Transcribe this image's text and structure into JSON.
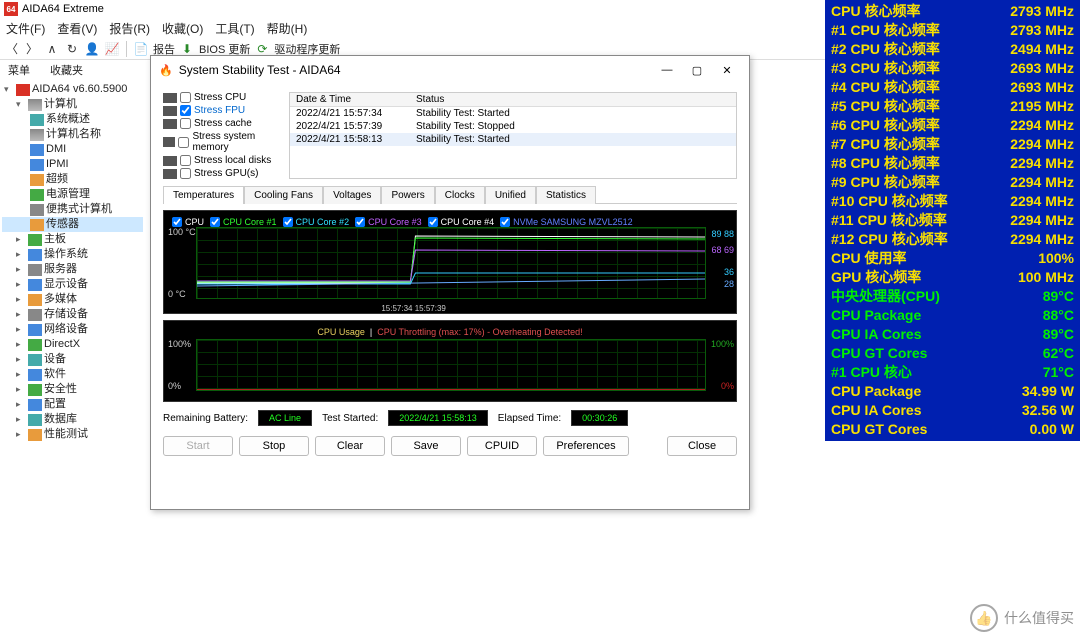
{
  "app": {
    "title": "AIDA64 Extreme"
  },
  "menu": [
    "文件(F)",
    "查看(V)",
    "报告(R)",
    "收藏(O)",
    "工具(T)",
    "帮助(H)"
  ],
  "toolbar": {
    "report": "报告",
    "bios": "BIOS 更新",
    "driver": "驱动程序更新"
  },
  "subheader": {
    "menu": "菜单",
    "fav": "收藏夹"
  },
  "tree": {
    "root": "AIDA64 v6.60.5900",
    "computer": "计算机",
    "sys_summary": "系统概述",
    "computer_name": "计算机名称",
    "dmi": "DMI",
    "ipmi": "IPMI",
    "overclock": "超频",
    "power": "电源管理",
    "portable": "便携式计算机",
    "sensors": "传感器",
    "mobo": "主板",
    "os": "操作系统",
    "server": "服务器",
    "display": "显示设备",
    "multimedia": "多媒体",
    "storage": "存储设备",
    "network": "网络设备",
    "directx": "DirectX",
    "device": "设备",
    "software": "软件",
    "security": "安全性",
    "config": "配置",
    "database": "数据库",
    "benchmark": "性能测试"
  },
  "dlg": {
    "title": "System Stability Test - AIDA64",
    "stress": {
      "cpu": "Stress CPU",
      "fpu": "Stress FPU",
      "cache": "Stress cache",
      "mem": "Stress system memory",
      "disk": "Stress local disks",
      "gpu": "Stress GPU(s)",
      "fpu_checked": true
    },
    "log_hdr": {
      "dt": "Date & Time",
      "st": "Status"
    },
    "log": [
      {
        "dt": "2022/4/21 15:57:34",
        "st": "Stability Test: Started"
      },
      {
        "dt": "2022/4/21 15:57:39",
        "st": "Stability Test: Stopped"
      },
      {
        "dt": "2022/4/21 15:58:13",
        "st": "Stability Test: Started"
      }
    ],
    "tabs": [
      "Temperatures",
      "Cooling Fans",
      "Voltages",
      "Powers",
      "Clocks",
      "Unified",
      "Statistics"
    ],
    "legend1": [
      {
        "label": "CPU",
        "color": "#ffffff"
      },
      {
        "label": "CPU Core #1",
        "color": "#30ff30"
      },
      {
        "label": "CPU Core #2",
        "color": "#30e0ff"
      },
      {
        "label": "CPU Core #3",
        "color": "#c060ff"
      },
      {
        "label": "CPU Core #4",
        "color": "#ffffff"
      },
      {
        "label": "NVMe SAMSUNG MZVL2512",
        "color": "#6080ff"
      }
    ],
    "g1": {
      "ymax": "100 °C",
      "ymin": "0 °C",
      "r_vals": [
        "89 88",
        "68 69",
        "36",
        "28"
      ],
      "r_colors": [
        "#3cf",
        "#b6f",
        "#3cf",
        "#6af"
      ],
      "xtick": "15:57:34  15:57:39"
    },
    "g2": {
      "hdr_usage": "CPU Usage",
      "hdr_throttle": "CPU Throttling (max: 17%) - Overheating Detected!",
      "ymax": "100%",
      "ymin": "0%",
      "r_top": "100%",
      "r_bot": "0%"
    },
    "status": {
      "battery_lbl": "Remaining Battery:",
      "battery_val": "AC Line",
      "started_lbl": "Test Started:",
      "started_val": "2022/4/21 15:58:13",
      "elapsed_lbl": "Elapsed Time:",
      "elapsed_val": "00:30:26"
    },
    "buttons": {
      "start": "Start",
      "stop": "Stop",
      "clear": "Clear",
      "save": "Save",
      "cpuid": "CPUID",
      "prefs": "Preferences",
      "close": "Close"
    }
  },
  "overlay": [
    {
      "l": "CPU 核心频率",
      "v": "2793 MHz",
      "c": "y"
    },
    {
      "l": "#1 CPU 核心频率",
      "v": "2793 MHz",
      "c": "y"
    },
    {
      "l": "#2 CPU 核心频率",
      "v": "2494 MHz",
      "c": "y"
    },
    {
      "l": "#3 CPU 核心频率",
      "v": "2693 MHz",
      "c": "y"
    },
    {
      "l": "#4 CPU 核心频率",
      "v": "2693 MHz",
      "c": "y"
    },
    {
      "l": "#5 CPU 核心频率",
      "v": "2195 MHz",
      "c": "y"
    },
    {
      "l": "#6 CPU 核心频率",
      "v": "2294 MHz",
      "c": "y"
    },
    {
      "l": "#7 CPU 核心频率",
      "v": "2294 MHz",
      "c": "y"
    },
    {
      "l": "#8 CPU 核心频率",
      "v": "2294 MHz",
      "c": "y"
    },
    {
      "l": "#9 CPU 核心频率",
      "v": "2294 MHz",
      "c": "y"
    },
    {
      "l": "#10 CPU 核心频率",
      "v": "2294 MHz",
      "c": "y"
    },
    {
      "l": "#11 CPU 核心频率",
      "v": "2294 MHz",
      "c": "y"
    },
    {
      "l": "#12 CPU 核心频率",
      "v": "2294 MHz",
      "c": "y"
    },
    {
      "l": "CPU 使用率",
      "v": "100%",
      "c": "y"
    },
    {
      "l": "GPU 核心频率",
      "v": "100 MHz",
      "c": "y"
    },
    {
      "l": "中央处理器(CPU)",
      "v": "89°C",
      "c": "g"
    },
    {
      "l": "CPU Package",
      "v": "88°C",
      "c": "g"
    },
    {
      "l": "CPU IA Cores",
      "v": "89°C",
      "c": "g"
    },
    {
      "l": "CPU GT Cores",
      "v": "62°C",
      "c": "g"
    },
    {
      "l": " #1 CPU 核心",
      "v": "71°C",
      "c": "g"
    },
    {
      "l": "CPU Package",
      "v": "34.99 W",
      "c": "y"
    },
    {
      "l": "CPU IA Cores",
      "v": "32.56 W",
      "c": "y"
    },
    {
      "l": "CPU GT Cores",
      "v": "0.00 W",
      "c": "y"
    }
  ],
  "watermark": "什么值得买",
  "chart_data": [
    {
      "type": "line",
      "title": "Temperatures",
      "ylabel": "°C",
      "ylim": [
        0,
        100
      ],
      "x_time_labels": [
        "15:57:34",
        "15:57:39"
      ],
      "series": [
        {
          "name": "CPU",
          "current": 89
        },
        {
          "name": "CPU Core #1",
          "current": 88
        },
        {
          "name": "CPU Core #2",
          "current": 68
        },
        {
          "name": "CPU Core #3",
          "current": 69
        },
        {
          "name": "CPU Core #4",
          "current": 36
        },
        {
          "name": "NVMe SAMSUNG MZVL2512",
          "current": 28
        }
      ],
      "note": "Temperatures low (~30-40°C) until 15:58:13, then step to ~88-89°C for CPU/Cores 1-2; Core #3 ~69; Core #4 ~36; NVMe ~28."
    },
    {
      "type": "line",
      "title": "CPU Usage / CPU Throttling",
      "ylabel": "%",
      "ylim": [
        0,
        100
      ],
      "series": [
        {
          "name": "CPU Usage",
          "current": 100
        },
        {
          "name": "CPU Throttling",
          "max": 17,
          "current": 0
        }
      ],
      "annotation": "Overheating Detected!"
    }
  ]
}
